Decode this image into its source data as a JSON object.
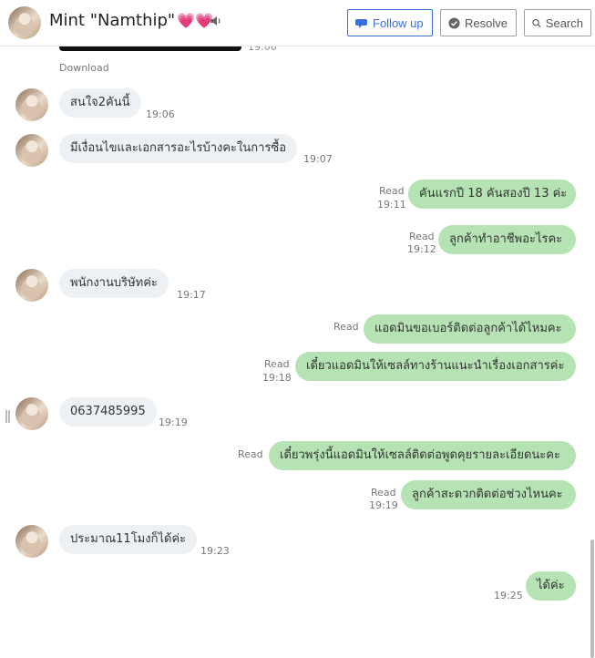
{
  "header": {
    "contact_name": "Mint \"Namthip\"",
    "hearts": "💗💗",
    "follow_up_label": "Follow up",
    "resolve_label": "Resolve",
    "search_label": "Search"
  },
  "colors": {
    "incoming_bubble": "#eef1f4",
    "outgoing_bubble": "#b6e3b4",
    "accent": "#3b6fd8"
  },
  "attachment": {
    "download_label": "Download",
    "time": "19:06"
  },
  "messages": [
    {
      "dir": "in",
      "text": "สนใจ2คันนี้",
      "time": "19:06"
    },
    {
      "dir": "in",
      "text": "มีเงื่อนไขและเอกสารอะไรบ้างคะในการซื้อ",
      "time": "19:07"
    },
    {
      "dir": "out",
      "text": "คันแรกปี 18 คันสองปี 13 ค่ะ",
      "read": "Read",
      "time": "19:11"
    },
    {
      "dir": "out",
      "text": "ลูกค้าทำอาชีพอะไรคะ",
      "read": "Read",
      "time": "19:12"
    },
    {
      "dir": "in",
      "text": "พนักงานบริษัทค่ะ",
      "time": "19:17"
    },
    {
      "dir": "out",
      "text": "แอดมินขอเบอร์ติดต่อลูกค้าได้ไหมคะ",
      "read": "Read",
      "time": ""
    },
    {
      "dir": "out",
      "text": "เดี๋ยวแอดมินให้เซลล์ทางร้านแนะนำเรื่องเอกสารค่ะ",
      "read": "Read",
      "time": "19:18"
    },
    {
      "dir": "in",
      "text": "0637485995",
      "time": "19:19"
    },
    {
      "dir": "out",
      "text": "เดี๋ยวพรุ่งนี้แอดมินให้เซลล์ติดต่อพูดคุยรายละเอียดนะคะ",
      "read": "Read",
      "time": ""
    },
    {
      "dir": "out",
      "text": "ลูกค้าสะดวกติดต่อช่วงไหนคะ",
      "read": "Read",
      "time": "19:19"
    },
    {
      "dir": "in",
      "text": "ประมาณ11โมงก็ได้ค่ะ",
      "time": "19:23"
    },
    {
      "dir": "out",
      "text": "ได้ค่ะ",
      "read": "",
      "time": "19:25"
    }
  ]
}
